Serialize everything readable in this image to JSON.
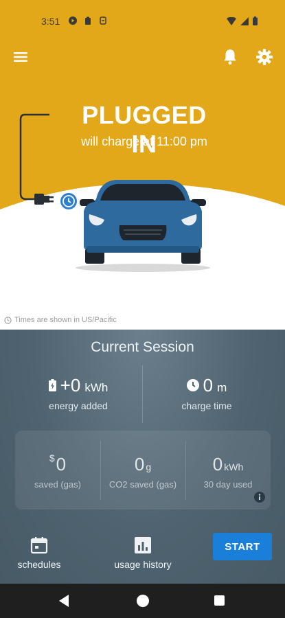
{
  "colors": {
    "hero": "#e3a81a",
    "panel": "#4f6370",
    "accent": "#1a7fd8",
    "car": "#2e6a9e"
  },
  "status_bar": {
    "time": "3:51",
    "notification_icons": [
      "media-icon",
      "clipboard-icon",
      "sync-icon"
    ],
    "system_icons": [
      "wifi-icon",
      "signal-icon",
      "battery-icon"
    ]
  },
  "top_bar": {
    "icons": [
      "menu-icon",
      "bell-icon",
      "gear-icon"
    ]
  },
  "charger": {
    "status": "PLUGGED IN",
    "message": "will charge at 11:00 pm",
    "timezone_note": "Times are shown in US/Pacific"
  },
  "session": {
    "title": "Current Session",
    "energy": {
      "value": "+0",
      "unit": "kWh",
      "label": "energy added"
    },
    "charge_time": {
      "value": "0",
      "unit": "m",
      "label": "charge time"
    }
  },
  "savings": [
    {
      "prefix": "$",
      "value": "0",
      "suffix": "",
      "label": "saved (gas)"
    },
    {
      "prefix": "",
      "value": "0",
      "suffix": "g",
      "label": "CO2 saved (gas)"
    },
    {
      "prefix": "",
      "value": "0",
      "suffix": "kWh",
      "label": "30 day used"
    }
  ],
  "bottom_nav": {
    "schedules": "schedules",
    "usage_history": "usage history",
    "start": "START"
  }
}
